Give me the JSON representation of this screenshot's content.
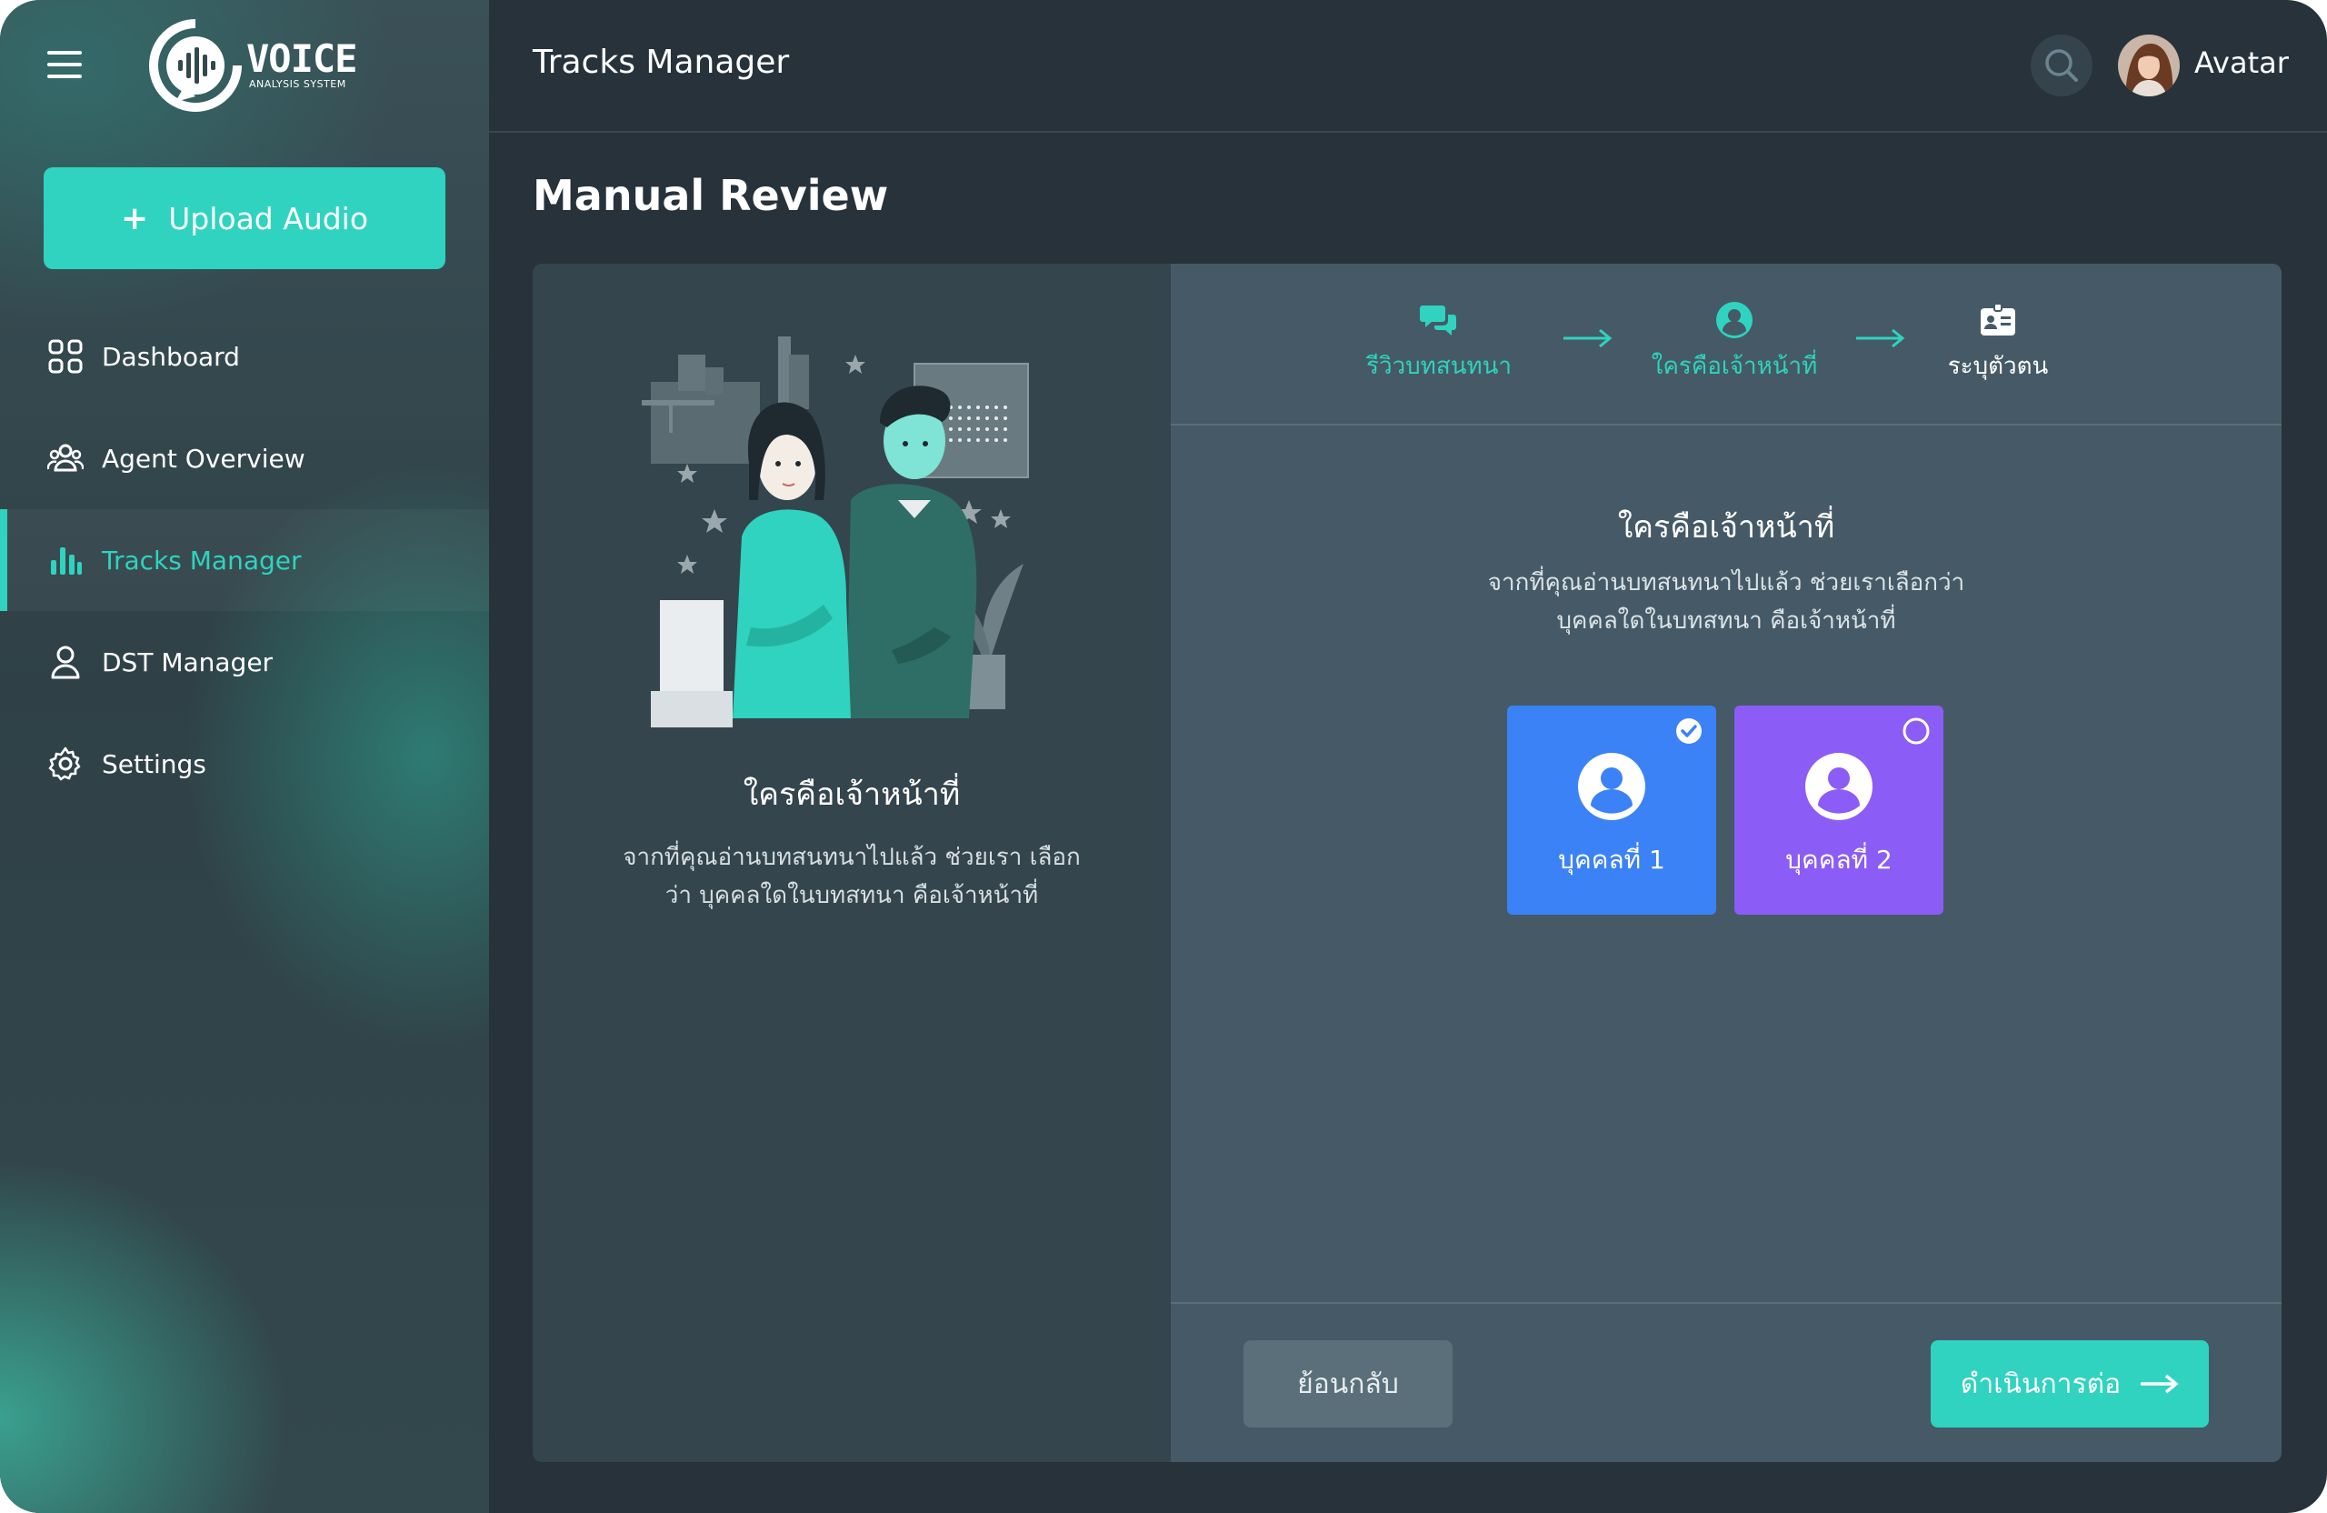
{
  "app": {
    "logo_word": "VOICE",
    "logo_sub": "ANALYSIS SYSTEM"
  },
  "sidebar": {
    "upload_label": "Upload Audio",
    "items": [
      {
        "label": "Dashboard",
        "icon": "grid-icon"
      },
      {
        "label": "Agent Overview",
        "icon": "users-icon"
      },
      {
        "label": "Tracks Manager",
        "icon": "bar-chart-icon",
        "active": true
      },
      {
        "label": "DST Manager",
        "icon": "user-icon"
      },
      {
        "label": "Settings",
        "icon": "gear-icon"
      }
    ]
  },
  "header": {
    "title": "Tracks Manager",
    "avatar_name": "Avatar"
  },
  "page": {
    "title": "Manual Review"
  },
  "left_panel": {
    "heading": "ใครคือเจ้าหน้าที่",
    "description": "จากที่คุณอ่านบทสนทนาไปแล้ว ช่วยเรา เลือกว่า บุคคลใดในบทสทนา คือเจ้าหน้าที่"
  },
  "stepper": {
    "steps": [
      {
        "label": "รีวิวบทสนทนา",
        "icon": "chat-icon",
        "state": "done"
      },
      {
        "label": "ใครคือเจ้าหน้าที่",
        "icon": "user-circle-icon",
        "state": "current"
      },
      {
        "label": "ระบุตัวตน",
        "icon": "id-card-icon",
        "state": "pending"
      }
    ]
  },
  "question": {
    "title": "ใครคือเจ้าหน้าที่",
    "line1": "จากที่คุณอ่านบทสนทนาไปแล้ว ช่วยเราเลือกว่า",
    "line2": "บุคคลใดในบทสทนา คือเจ้าหน้าที่"
  },
  "persons": [
    {
      "label": "บุคคลที่ 1",
      "selected": true,
      "color": "#3b82f6"
    },
    {
      "label": "บุคคลที่ 2",
      "selected": false,
      "color": "#8b5cf6"
    }
  ],
  "footer": {
    "back_label": "ย้อนกลับ",
    "next_label": "ดำเนินการต่อ"
  },
  "colors": {
    "accent": "#2fd3bf",
    "background": "#27323a"
  }
}
